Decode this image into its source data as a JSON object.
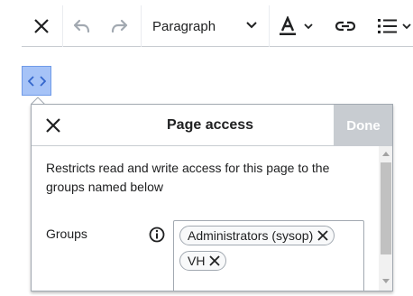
{
  "toolbar": {
    "close_icon": "close-icon",
    "undo_icon": "undo-icon",
    "redo_icon": "redo-icon",
    "format_value": "Paragraph",
    "style_icon": "text-style-icon",
    "link_icon": "link-icon",
    "list_icon": "list-icon"
  },
  "code_node": {
    "icon": "code-icon"
  },
  "dialog": {
    "title": "Page access",
    "done_label": "Done",
    "description": "Restricts read and write access for this page to the groups named below",
    "groups_label": "Groups",
    "groups": [
      {
        "label": "Administrators (sysop)"
      },
      {
        "label": "VH"
      }
    ]
  },
  "colors": {
    "done_disabled_bg": "#c8ccd1",
    "code_node_bg": "#a6c3f7",
    "border": "#a2a9b1"
  }
}
